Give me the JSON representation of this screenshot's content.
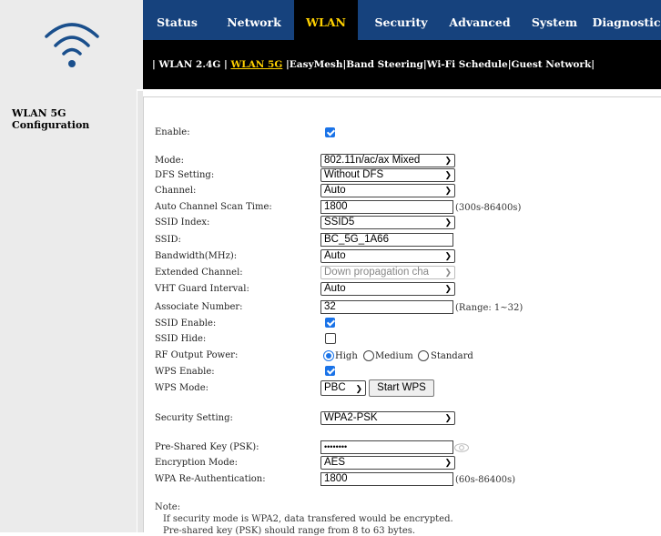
{
  "nav": {
    "tabs": [
      {
        "label": "Status"
      },
      {
        "label": "Network"
      },
      {
        "label": "WLAN"
      },
      {
        "label": "Security"
      },
      {
        "label": "Advanced"
      },
      {
        "label": "System"
      },
      {
        "label": "Diagnostic"
      }
    ],
    "active_tab": "WLAN",
    "subnav": [
      {
        "label": "WLAN 2.4G"
      },
      {
        "label": "WLAN 5G"
      },
      {
        "label": "EasyMesh"
      },
      {
        "label": "Band Steering"
      },
      {
        "label": "Wi-Fi Schedule"
      },
      {
        "label": "Guest Network"
      }
    ],
    "active_subnav": "WLAN 5G",
    "separator": "|"
  },
  "sidebar": {
    "title": "WLAN 5G Configuration"
  },
  "form": {
    "enable": {
      "label": "Enable:",
      "checked": true
    },
    "mode": {
      "label": "Mode:",
      "value": "802.11n/ac/ax Mixed"
    },
    "dfs": {
      "label": "DFS Setting:",
      "value": "Without DFS"
    },
    "channel": {
      "label": "Channel:",
      "value": "Auto"
    },
    "scan_time": {
      "label": "Auto Channel Scan Time:",
      "value": "1800",
      "hint": "(300s-86400s)"
    },
    "ssid_index": {
      "label": "SSID Index:",
      "value": "SSID5"
    },
    "ssid": {
      "label": "SSID:",
      "value": "BC_5G_1A66"
    },
    "bandwidth": {
      "label": "Bandwidth(MHz):",
      "value": "Auto"
    },
    "ext_channel": {
      "label": "Extended Channel:",
      "value": "Down propagation cha"
    },
    "vht_guard": {
      "label": "VHT Guard Interval:",
      "value": "Auto"
    },
    "assoc_number": {
      "label": "Associate Number:",
      "value": "32",
      "hint": "(Range: 1~32)"
    },
    "ssid_enable": {
      "label": "SSID Enable:",
      "checked": true
    },
    "ssid_hide": {
      "label": "SSID Hide:",
      "checked": false
    },
    "rf_power": {
      "label": "RF Output Power:",
      "options": [
        "High",
        "Medium",
        "Standard"
      ],
      "selected": "High"
    },
    "wps_enable": {
      "label": "WPS Enable:",
      "checked": true
    },
    "wps_mode": {
      "label": "WPS Mode:",
      "value": "PBC",
      "button": "Start WPS"
    },
    "security": {
      "label": "Security Setting:",
      "value": "WPA2-PSK"
    },
    "psk": {
      "label": "Pre-Shared Key (PSK):",
      "value": "••••••••"
    },
    "encryption": {
      "label": "Encryption Mode:",
      "value": "AES"
    },
    "reauth": {
      "label": "WPA Re-Authentication:",
      "value": "1800",
      "hint": "(60s-86400s)"
    }
  },
  "notes": {
    "title": "Note:",
    "line1": "If security mode is WPA2, data transfered would be encrypted.",
    "line2": "Pre-shared key (PSK) should range from 8 to 63 bytes."
  },
  "colors": {
    "nav_bg": "#16427d",
    "active_text": "#ffd100",
    "checkbox": "#1a73e8"
  }
}
